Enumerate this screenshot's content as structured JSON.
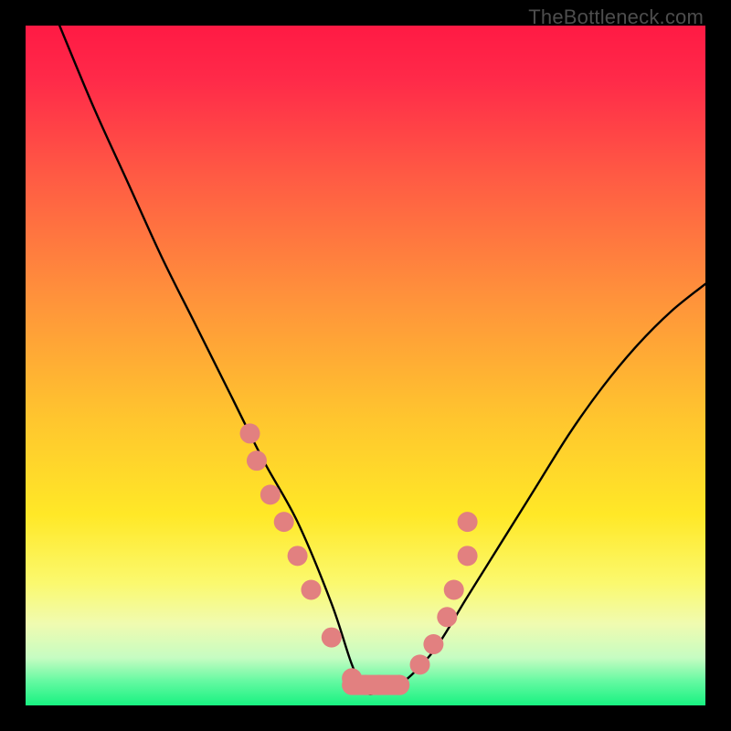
{
  "watermark": "TheBottleneck.com",
  "gradient_stops": [
    {
      "offset": 0,
      "color": "#ff1a44"
    },
    {
      "offset": 0.08,
      "color": "#ff2a49"
    },
    {
      "offset": 0.22,
      "color": "#ff5a44"
    },
    {
      "offset": 0.4,
      "color": "#ff923b"
    },
    {
      "offset": 0.58,
      "color": "#ffc62e"
    },
    {
      "offset": 0.72,
      "color": "#ffe827"
    },
    {
      "offset": 0.82,
      "color": "#fbf96e"
    },
    {
      "offset": 0.88,
      "color": "#f0fbb0"
    },
    {
      "offset": 0.93,
      "color": "#c6fcc2"
    },
    {
      "offset": 0.965,
      "color": "#63f9a1"
    },
    {
      "offset": 1.0,
      "color": "#18f281"
    }
  ],
  "marker_color": "#e28080",
  "marker_radius": 11,
  "chart_data": {
    "type": "line",
    "title": "",
    "xlabel": "",
    "ylabel": "",
    "xlim": [
      0,
      100
    ],
    "ylim": [
      0,
      100
    ],
    "grid": false,
    "legend": false,
    "series": [
      {
        "name": "bottleneck-curve",
        "x": [
          5,
          10,
          15,
          20,
          25,
          30,
          35,
          40,
          45,
          48,
          50,
          52,
          55,
          60,
          65,
          70,
          75,
          80,
          85,
          90,
          95,
          100
        ],
        "y": [
          100,
          88,
          77,
          66,
          56,
          46,
          36,
          27,
          15,
          6,
          2,
          2,
          3,
          8,
          16,
          24,
          32,
          40,
          47,
          53,
          58,
          62
        ]
      },
      {
        "name": "highlight-markers",
        "x": [
          33,
          34,
          36,
          38,
          40,
          42,
          45,
          48,
          50,
          52,
          55,
          58,
          60,
          62,
          63,
          65,
          65
        ],
        "y": [
          40,
          36,
          31,
          27,
          22,
          17,
          10,
          4,
          3,
          3,
          3,
          6,
          9,
          13,
          17,
          22,
          27
        ]
      }
    ]
  }
}
